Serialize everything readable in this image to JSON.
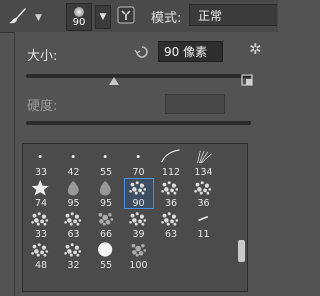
{
  "toolbar": {
    "tool_icon": "brush-icon",
    "brush_size": "90",
    "mode_label": "模式:",
    "mode_value": "正常"
  },
  "brush_panel": {
    "size_label": "大小:",
    "size_value": "90 像素",
    "size_fraction": 0.39,
    "hardness_label": "硬度:",
    "brushes": [
      {
        "label": "33",
        "shape": "dot-small"
      },
      {
        "label": "42",
        "shape": "dot-small"
      },
      {
        "label": "55",
        "shape": "dot-small"
      },
      {
        "label": "70",
        "shape": "dot-small"
      },
      {
        "label": "112",
        "shape": "stroke-curve"
      },
      {
        "label": "134",
        "shape": "stroke-fan"
      },
      {
        "label": "74",
        "shape": "star"
      },
      {
        "label": "95",
        "shape": "drop"
      },
      {
        "label": "95",
        "shape": "drop"
      },
      {
        "label": "90",
        "shape": "texture",
        "selected": true
      },
      {
        "label": "36",
        "shape": "texture"
      },
      {
        "label": "36",
        "shape": "texture"
      },
      {
        "label": "33",
        "shape": "texture"
      },
      {
        "label": "63",
        "shape": "texture"
      },
      {
        "label": "66",
        "shape": "texture-dark"
      },
      {
        "label": "39",
        "shape": "texture"
      },
      {
        "label": "63",
        "shape": "texture"
      },
      {
        "label": "11",
        "shape": "dash"
      },
      {
        "label": "48",
        "shape": "texture"
      },
      {
        "label": "32",
        "shape": "texture"
      },
      {
        "label": "55",
        "shape": "circle"
      },
      {
        "label": "100",
        "shape": "texture-dark"
      }
    ]
  }
}
